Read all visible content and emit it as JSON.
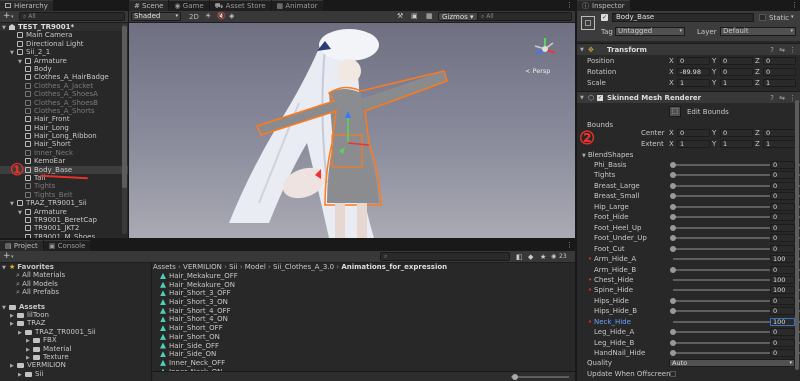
{
  "hierarchy": {
    "tab": "Hierarchy",
    "search_placeholder": "All",
    "add_label": "+",
    "root": "TEST_TR9001*",
    "items": [
      {
        "label": "Main Camera",
        "indent": 1,
        "dim": false
      },
      {
        "label": "Directional Light",
        "indent": 1,
        "dim": false
      },
      {
        "label": "Sii_2_1",
        "indent": 1,
        "dim": false,
        "fold": true
      },
      {
        "label": "Armature",
        "indent": 2,
        "dim": false,
        "fold": true
      },
      {
        "label": "Body",
        "indent": 2,
        "dim": false
      },
      {
        "label": "Clothes_A_HairBadge",
        "indent": 2,
        "dim": false
      },
      {
        "label": "Clothes_A_Jacket",
        "indent": 2,
        "dim": true
      },
      {
        "label": "Clothes_A_ShoesA",
        "indent": 2,
        "dim": true
      },
      {
        "label": "Clothes_A_ShoesB",
        "indent": 2,
        "dim": true
      },
      {
        "label": "Clothes_A_Shorts",
        "indent": 2,
        "dim": true
      },
      {
        "label": "Hair_Front",
        "indent": 2,
        "dim": false
      },
      {
        "label": "Hair_Long",
        "indent": 2,
        "dim": false
      },
      {
        "label": "Hair_Long_Ribbon",
        "indent": 2,
        "dim": false
      },
      {
        "label": "Hair_Short",
        "indent": 2,
        "dim": false
      },
      {
        "label": "Inner_Neck",
        "indent": 2,
        "dim": true
      },
      {
        "label": "KemoEar",
        "indent": 2,
        "dim": false
      },
      {
        "label": "Body_Base",
        "indent": 2,
        "dim": false,
        "selected": true
      },
      {
        "label": "Tail",
        "indent": 2,
        "dim": false
      },
      {
        "label": "Tights",
        "indent": 2,
        "dim": true
      },
      {
        "label": "Tights_Belt",
        "indent": 2,
        "dim": true
      },
      {
        "label": "TRAZ_TR9001_Sii",
        "indent": 1,
        "dim": false,
        "fold": true
      },
      {
        "label": "Armature",
        "indent": 2,
        "dim": false,
        "fold": true
      },
      {
        "label": "TR9001_BeretCap",
        "indent": 2,
        "dim": false
      },
      {
        "label": "TR9001_JKT2",
        "indent": 2,
        "dim": false
      },
      {
        "label": "TR9001_M_Shoes",
        "indent": 2,
        "dim": false
      }
    ]
  },
  "scene_view": {
    "tabs": [
      "Scene",
      "Game",
      "Asset Store",
      "Animator"
    ],
    "shading_mode": "Shaded",
    "mode_2d": "2D",
    "gizmos": "Gizmos",
    "search_placeholder": "All",
    "persp_label": "< Persp"
  },
  "project": {
    "tabs": [
      "Project",
      "Console"
    ],
    "add_label": "+",
    "count_label": "23",
    "favorites_label": "Favorites",
    "favorites": [
      "All Materials",
      "All Models",
      "All Prefabs"
    ],
    "assets_label": "Assets",
    "assets_tree": [
      {
        "label": "lilToon",
        "indent": 1
      },
      {
        "label": "TRAZ",
        "indent": 1
      },
      {
        "label": "TRAZ_TR0001_Sii",
        "indent": 2
      },
      {
        "label": "FBX",
        "indent": 3
      },
      {
        "label": "Material",
        "indent": 3
      },
      {
        "label": "Texture",
        "indent": 3
      },
      {
        "label": "VERMILION",
        "indent": 1
      },
      {
        "label": "Sii",
        "indent": 2
      }
    ],
    "breadcrumb": [
      "Assets",
      "VERMILION",
      "Sii",
      "Model",
      "Sii_Clothes_A_3.0",
      "Animations_for_expression"
    ],
    "files": [
      "Hair_Mekakure_OFF",
      "Hair_Mekakure_ON",
      "Hair_Short_3_OFF",
      "Hair_Short_3_ON",
      "Hair_Short_4_OFF",
      "Hair_Short_4_ON",
      "Hair_Short_OFF",
      "Hair_Short_ON",
      "Hair_Side_OFF",
      "Hair_Side_ON",
      "Inner_Neck_OFF",
      "Inner_Neck_ON"
    ]
  },
  "inspector": {
    "tab": "Inspector",
    "object_name": "Body_Base",
    "static_label": "Static",
    "tag_label": "Tag",
    "tag_value": "Untagged",
    "layer_label": "Layer",
    "layer_value": "Default",
    "transform": {
      "title": "Transform",
      "position": {
        "label": "Position",
        "x": "0",
        "y": "0",
        "z": "0"
      },
      "rotation": {
        "label": "Rotation",
        "x": "-89.98",
        "y": "0",
        "z": "0"
      },
      "scale": {
        "label": "Scale",
        "x": "1",
        "y": "1",
        "z": "1"
      }
    },
    "renderer": {
      "title": "Skinned Mesh Renderer",
      "edit_bounds": "Edit Bounds",
      "bounds_label": "Bounds",
      "center": {
        "label": "Center",
        "x": "0",
        "y": "0",
        "z": "0"
      },
      "extent": {
        "label": "Extent",
        "x": "1",
        "y": "1",
        "z": "1"
      },
      "blendshapes_label": "BlendShapes",
      "quality_label": "Quality",
      "quality_value": "Auto",
      "update_offscreen_label": "Update When Offscreen"
    },
    "blendshapes": [
      {
        "name": "Phi_Basis",
        "value": 0,
        "display": "0"
      },
      {
        "name": "Tights",
        "value": 0,
        "display": "0"
      },
      {
        "name": "Breast_Large",
        "value": 0,
        "display": "0"
      },
      {
        "name": "Breast_Small",
        "value": 0,
        "display": "0"
      },
      {
        "name": "Hip_Large",
        "value": 0,
        "display": "0"
      },
      {
        "name": "Foot_Hide",
        "value": 0,
        "display": "0"
      },
      {
        "name": "Foot_Heel_Up",
        "value": 0,
        "display": "0"
      },
      {
        "name": "Foot_Under_Up",
        "value": 0,
        "display": "0"
      },
      {
        "name": "Foot_Cut",
        "value": 0,
        "display": "0"
      },
      {
        "name": "Arm_Hide_A",
        "value": 100,
        "display": "100",
        "marked": true
      },
      {
        "name": "Arm_Hide_B",
        "value": 0,
        "display": "0"
      },
      {
        "name": "Chest_Hide",
        "value": 100,
        "display": "100",
        "marked": true
      },
      {
        "name": "Spine_Hide",
        "value": 100,
        "display": "100",
        "marked": true
      },
      {
        "name": "Hips_Hide",
        "value": 0,
        "display": "0"
      },
      {
        "name": "Hips_Hide_B",
        "value": 0,
        "display": "0"
      },
      {
        "name": "Neck_Hide",
        "value": 100,
        "display": "100",
        "marked": true,
        "active": true
      },
      {
        "name": "Leg_Hide_A",
        "value": 0,
        "display": "0"
      },
      {
        "name": "Leg_Hide_B",
        "value": 0,
        "display": "0"
      },
      {
        "name": "HandNail_Hide",
        "value": 0,
        "display": "0"
      }
    ]
  },
  "annotations": {
    "mark1": "①",
    "mark2": "②"
  },
  "colors": {
    "accent": "#3a72c8",
    "annotation": "#e6322a",
    "selection": "#ff7a1a"
  }
}
